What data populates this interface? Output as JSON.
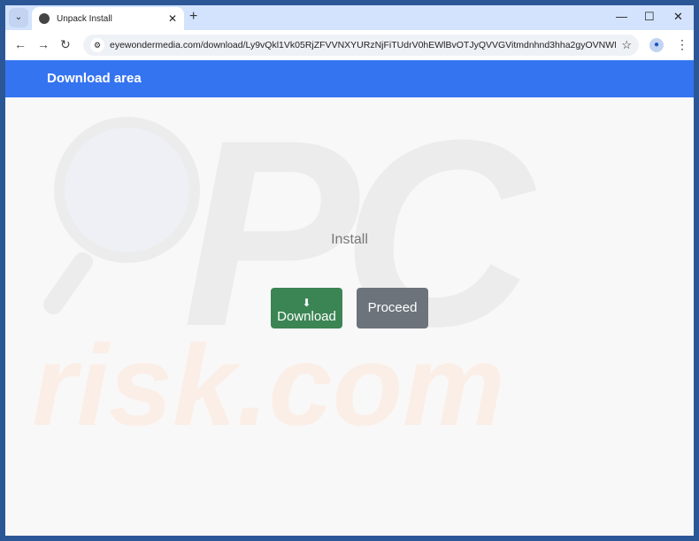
{
  "browser": {
    "tab_title": "Unpack Install",
    "url": "eyewondermedia.com/download/Ly9vQkl1Vk05RjZFVVNXYURzNjFiTUdrV0hEWlBvOTJyQVVGVitmdnhnd3hha2gyOVNWNm5z..."
  },
  "page": {
    "header_title": "Download area",
    "heading": "Install",
    "download_label": "Download",
    "proceed_label": "Proceed"
  },
  "watermark": {
    "text_top": "PC",
    "text_bottom": "risk.com"
  },
  "colors": {
    "header": "#3574f0",
    "download": "#3b8554",
    "proceed": "#6c737b"
  }
}
